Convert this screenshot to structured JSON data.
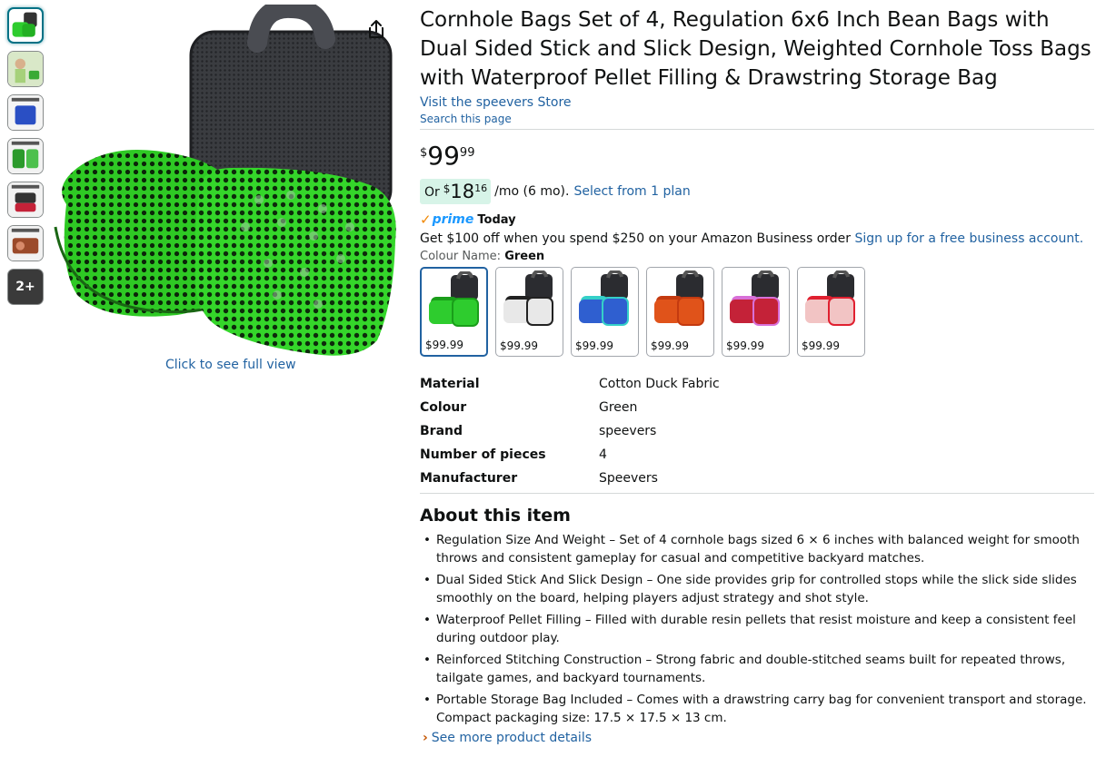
{
  "thumbnails": [
    {
      "icon": "cornhole-green-thumb"
    },
    {
      "icon": "lifestyle-thumb"
    },
    {
      "icon": "blue-bags-thumb"
    },
    {
      "icon": "dual-surface-thumb"
    },
    {
      "icon": "premium-case-thumb"
    },
    {
      "icon": "weatherproof-thumb"
    }
  ],
  "more_thumbs": "2+",
  "full_view_text": "Click to see full view",
  "product": {
    "title": "Cornhole Bags Set of 4, Regulation 6x6 Inch Bean Bags with Dual Sided Stick and Slick Design, Weighted Cornhole Toss Bags with Waterproof Pellet Filling & Drawstring Storage Bag",
    "store_link": "Visit the speevers Store",
    "search_page": "Search this page"
  },
  "price": {
    "symbol": "$",
    "whole": "99",
    "fraction": "99"
  },
  "monthly": {
    "or": "Or",
    "symbol": "$",
    "whole": "18",
    "fraction": "16",
    "per_month": "/mo (6 mo).",
    "plan_link": "Select from 1 plan"
  },
  "prime": {
    "check": "✓",
    "label": "prime",
    "today": "Today"
  },
  "business": {
    "text": "Get $100 off when you spend $250 on your Amazon Business order ",
    "link": "Sign up for a free business account."
  },
  "colour": {
    "label": "Colour Name: ",
    "value": "Green"
  },
  "swatches": [
    {
      "price": "$99.99",
      "color": "#2ecc2e",
      "accent": "#1a9e1a",
      "selected": true
    },
    {
      "price": "$99.99",
      "color": "#e8e8e8",
      "accent": "#222222",
      "selected": false
    },
    {
      "price": "$99.99",
      "color": "#2f5fd0",
      "accent": "#35d0c8",
      "selected": false
    },
    {
      "price": "$99.99",
      "color": "#e0531a",
      "accent": "#c43a10",
      "selected": false
    },
    {
      "price": "$99.99",
      "color": "#c42238",
      "accent": "#d870d8",
      "selected": false
    },
    {
      "price": "$99.99",
      "color": "#f2c4c4",
      "accent": "#e02030",
      "selected": false
    }
  ],
  "specs": [
    {
      "key": "Material",
      "value": "Cotton Duck Fabric"
    },
    {
      "key": "Colour",
      "value": "Green"
    },
    {
      "key": "Brand",
      "value": "speevers"
    },
    {
      "key": "Number of pieces",
      "value": "4"
    },
    {
      "key": "Manufacturer",
      "value": "Speevers"
    }
  ],
  "about": {
    "title": "About this item",
    "bullets": [
      "Regulation Size And Weight – Set of 4 cornhole bags sized 6 × 6 inches with balanced weight for smooth throws and consistent gameplay for casual and competitive backyard matches.",
      "Dual Sided Stick And Slick Design – One side provides grip for controlled stops while the slick side slides smoothly on the board, helping players adjust strategy and shot style.",
      "Waterproof Pellet Filling – Filled with durable resin pellets that resist moisture and keep a consistent feel during outdoor play.",
      "Reinforced Stitching Construction – Strong fabric and double-stitched seams built for repeated throws, tailgate games, and backyard tournaments.",
      "Portable Storage Bag Included – Comes with a drawstring carry bag for convenient transport and storage. Compact packaging size: 17.5 × 17.5 × 13 cm."
    ],
    "more_link": "See more product details"
  },
  "colors": {
    "link": "#2162a1",
    "accent_orange": "#c45500",
    "prime_blue": "#1a98ff",
    "monthly_bg": "#d7f4e8"
  }
}
